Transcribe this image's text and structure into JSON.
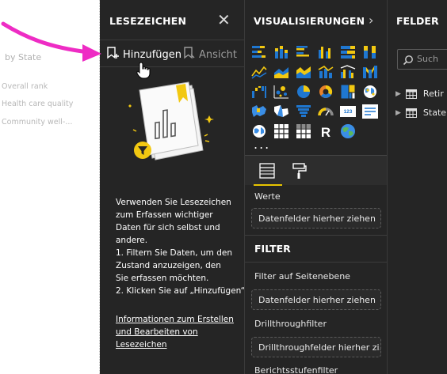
{
  "canvas": {
    "title": "by State",
    "items": [
      "Overall rank",
      "Health care quality",
      "Community well-..."
    ]
  },
  "bookmarks": {
    "title": "LESEZEICHEN",
    "close_icon": "close-icon",
    "add_label": "Hinzufügen",
    "view_label": "Ansicht",
    "description": [
      "Verwenden Sie Lesezeichen",
      "zum Erfassen wichtiger",
      "Daten für sich selbst und",
      "andere.",
      "1. Filtern Sie Daten, um den",
      "Zustand anzuzeigen, den",
      "Sie erfassen möchten.",
      "2. Klicken Sie auf „Hinzufügen“."
    ],
    "link_lines": [
      "Informationen zum Erstellen",
      "und Bearbeiten von",
      "Lesezeichen"
    ]
  },
  "visualizations": {
    "title": "VISUALISIERUNGEN",
    "more": "...",
    "icons": [
      "stacked-bar-icon",
      "stacked-column-icon",
      "clustered-bar-icon",
      "clustered-column-icon",
      "100-percent-bar-icon",
      "100-percent-column-icon",
      "line-chart-icon",
      "area-chart-icon",
      "stacked-area-icon",
      "line-column-icon",
      "line-clustered-column-icon",
      "ribbon-chart-icon",
      "waterfall-icon",
      "scatter-icon",
      "pie-icon",
      "donut-icon",
      "treemap-icon",
      "map-icon",
      "filled-map-icon",
      "shape-map-icon",
      "funnel-icon",
      "gauge-icon",
      "card-icon",
      "kpi-icon",
      "slicer-icon",
      "table-icon",
      "matrix-icon",
      "r-visual-icon",
      "globe-icon"
    ],
    "values_label": "Werte",
    "values_placeholder": "Datenfelder hierher ziehen",
    "filter_title": "FILTER",
    "page_filter_label": "Filter auf Seitenebene",
    "page_filter_placeholder": "Datenfelder hierher ziehen",
    "drillthrough_label": "Drillthroughfilter",
    "drillthrough_placeholder": "Drillthroughfelder hierher zi...",
    "report_filter_label": "Berichtsstufenfilter"
  },
  "fields": {
    "title": "FELDER",
    "search_placeholder": "Such",
    "tables": [
      "Retir",
      "State"
    ]
  },
  "colors": {
    "pane_bg": "#252525",
    "accent_yellow": "#e8c500",
    "annotation_magenta": "#ee2cc4"
  }
}
